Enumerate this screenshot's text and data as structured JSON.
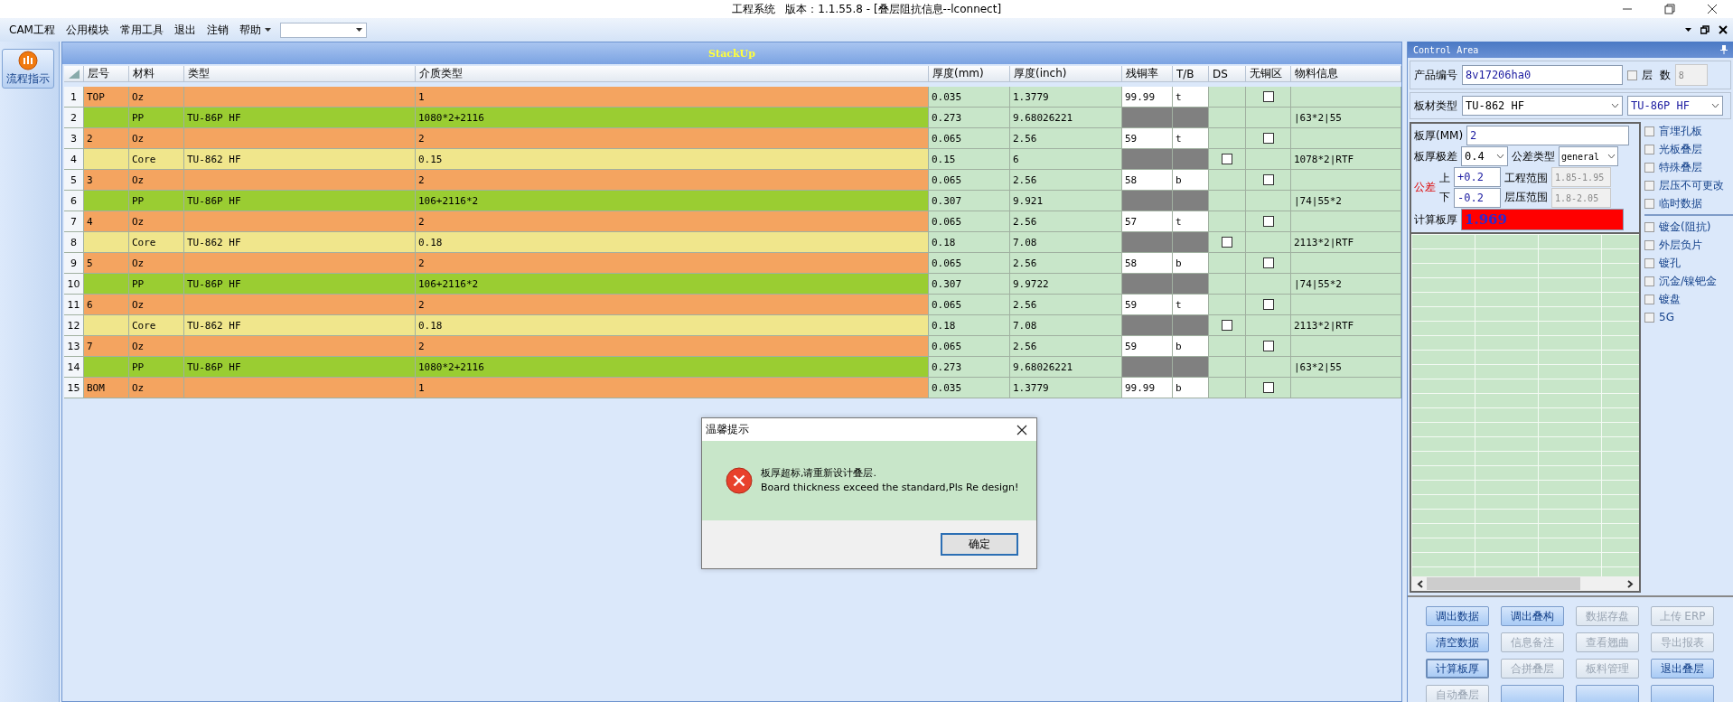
{
  "window": {
    "title": "工程系统   版本：1.1.55.8 - [叠层阻抗信息--lconnect]"
  },
  "menu": [
    {
      "label": "CAM工程"
    },
    {
      "label": "公用模块"
    },
    {
      "label": "常用工具"
    },
    {
      "label": "退出"
    },
    {
      "label": "注销"
    },
    {
      "label": "帮助",
      "dropdown": true
    }
  ],
  "side_button": {
    "label": "流程指示"
  },
  "stackup": {
    "title": "StackUp",
    "columns": [
      "层号",
      "材料",
      "类型",
      "介质类型",
      "厚度(mm)",
      "厚度(inch)",
      "残铜率",
      "T/B",
      "DS",
      "无铜区",
      "物料信息"
    ],
    "rows": [
      {
        "no": "1",
        "kind": "copper",
        "layer": "TOP",
        "material": "Oz",
        "dielectric": "1",
        "thick_mm": "0.035",
        "thick_inch": "1.3779",
        "copper_rate": "99.99",
        "tb": "t",
        "no_copper": {
          "checked": false
        }
      },
      {
        "no": "2",
        "kind": "pp",
        "material": "PP",
        "type": "TU-86P HF",
        "dielectric": "1080*2+2116",
        "thick_mm": "0.273",
        "thick_inch": "9.68026221",
        "info": "|63*2|55"
      },
      {
        "no": "3",
        "kind": "copper",
        "layer": "2",
        "material": "Oz",
        "dielectric": "2",
        "thick_mm": "0.065",
        "thick_inch": "2.56",
        "copper_rate": "59",
        "tb": "t",
        "no_copper": {
          "checked": false
        }
      },
      {
        "no": "4",
        "kind": "core",
        "material": "Core",
        "type": "TU-862 HF",
        "dielectric": "0.15",
        "thick_mm": "0.15",
        "thick_inch": "6",
        "ds": {
          "checked": false
        },
        "info": "1078*2|RTF"
      },
      {
        "no": "5",
        "kind": "copper",
        "layer": "3",
        "material": "Oz",
        "dielectric": "2",
        "thick_mm": "0.065",
        "thick_inch": "2.56",
        "copper_rate": "58",
        "tb": "b",
        "no_copper": {
          "checked": false
        }
      },
      {
        "no": "6",
        "kind": "pp",
        "material": "PP",
        "type": "TU-86P HF",
        "dielectric": "106+2116*2",
        "thick_mm": "0.307",
        "thick_inch": "9.921",
        "info": "|74|55*2"
      },
      {
        "no": "7",
        "kind": "copper",
        "layer": "4",
        "material": "Oz",
        "dielectric": "2",
        "thick_mm": "0.065",
        "thick_inch": "2.56",
        "copper_rate": "57",
        "tb": "t",
        "no_copper": {
          "checked": false
        }
      },
      {
        "no": "8",
        "kind": "core",
        "material": "Core",
        "type": "TU-862 HF",
        "dielectric": "0.18",
        "thick_mm": "0.18",
        "thick_inch": "7.08",
        "ds": {
          "checked": false
        },
        "info": "2113*2|RTF"
      },
      {
        "no": "9",
        "kind": "copper",
        "layer": "5",
        "material": "Oz",
        "dielectric": "2",
        "thick_mm": "0.065",
        "thick_inch": "2.56",
        "copper_rate": "58",
        "tb": "b",
        "no_copper": {
          "checked": false
        }
      },
      {
        "no": "10",
        "kind": "pp",
        "material": "PP",
        "type": "TU-86P HF",
        "dielectric": "106+2116*2",
        "thick_mm": "0.307",
        "thick_inch": "9.9722",
        "info": "|74|55*2"
      },
      {
        "no": "11",
        "kind": "copper",
        "layer": "6",
        "material": "Oz",
        "dielectric": "2",
        "thick_mm": "0.065",
        "thick_inch": "2.56",
        "copper_rate": "59",
        "tb": "t",
        "no_copper": {
          "checked": false
        }
      },
      {
        "no": "12",
        "kind": "core",
        "material": "Core",
        "type": "TU-862 HF",
        "dielectric": "0.18",
        "thick_mm": "0.18",
        "thick_inch": "7.08",
        "ds": {
          "checked": false
        },
        "info": "2113*2|RTF"
      },
      {
        "no": "13",
        "kind": "copper",
        "layer": "7",
        "material": "Oz",
        "dielectric": "2",
        "thick_mm": "0.065",
        "thick_inch": "2.56",
        "copper_rate": "59",
        "tb": "b",
        "no_copper": {
          "checked": false
        }
      },
      {
        "no": "14",
        "kind": "pp",
        "material": "PP",
        "type": "TU-86P HF",
        "dielectric": "1080*2+2116",
        "thick_mm": "0.273",
        "thick_inch": "9.68026221",
        "info": "|63*2|55"
      },
      {
        "no": "15",
        "kind": "copper",
        "layer": "BOM",
        "material": "Oz",
        "dielectric": "1",
        "thick_mm": "0.035",
        "thick_inch": "1.3779",
        "copper_rate": "99.99",
        "tb": "b",
        "no_copper": {
          "checked": false
        }
      }
    ]
  },
  "control_area": {
    "title": "Control Area",
    "product_label": "产品编号",
    "product_value": "8v17206ha0",
    "layers_label": "层  数",
    "layers_checked": false,
    "layers_value": "8",
    "material_label": "板材类型",
    "material_core": "TU-862 HF",
    "material_pp": "TU-86P HF",
    "thickness_label": "板厚(MM)",
    "thickness_value": "2",
    "range_label": "板厚极差",
    "range_value": "0.4",
    "tol_type_label": "公差类型",
    "tol_type_value": "general",
    "tol_label": "公差",
    "upper_label": "上",
    "upper_value": "+0.2",
    "lower_label": "下",
    "lower_value": "-0.2",
    "eng_range_label": "工程范围",
    "eng_range_value": "1.85-1.95",
    "press_range_label": "层压范围",
    "press_range_value": "1.8-2.05",
    "calc_label": "计算板厚",
    "calc_value": "1.969",
    "calc_alarm": true,
    "option_groups": [
      [
        {
          "label": "盲埋孔板",
          "checked": false
        },
        {
          "label": "光板叠层",
          "checked": false
        },
        {
          "label": "特殊叠层",
          "checked": false
        },
        {
          "label": "层压不可更改",
          "checked": false
        },
        {
          "label": "临时数据",
          "checked": false
        }
      ],
      [
        {
          "label": "镀金(阻抗)",
          "checked": false
        },
        {
          "label": "外层负片",
          "checked": false
        },
        {
          "label": "镀孔",
          "checked": false
        },
        {
          "label": "沉金/镍钯金",
          "checked": false
        },
        {
          "label": "镀盘",
          "checked": false
        },
        {
          "label": "5G",
          "checked": false
        }
      ]
    ],
    "buttons": [
      {
        "label": "调出数据",
        "enabled": true
      },
      {
        "label": "调出叠构",
        "enabled": true
      },
      {
        "label": "数据存盘",
        "enabled": false
      },
      {
        "label": "上传 ERP",
        "enabled": false
      },
      {
        "label": "清空数据",
        "enabled": true
      },
      {
        "label": "信息备注",
        "enabled": false
      },
      {
        "label": "查看翘曲",
        "enabled": false
      },
      {
        "label": "导出报表",
        "enabled": false
      },
      {
        "label": "计算板厚",
        "enabled": true,
        "selected": true
      },
      {
        "label": "合拼叠层",
        "enabled": false
      },
      {
        "label": "板料管理",
        "enabled": false
      },
      {
        "label": "退出叠层",
        "enabled": true
      },
      {
        "label": "自动叠层",
        "enabled": false
      },
      {
        "enabled": true
      },
      {
        "enabled": true
      },
      {
        "enabled": true
      }
    ]
  },
  "dialog": {
    "title": "温馨提示",
    "message_lines": [
      "板厚超标,请重新设计叠层.",
      "Board thickness exceed the standard,Pls Re design!"
    ],
    "button": "确定"
  }
}
